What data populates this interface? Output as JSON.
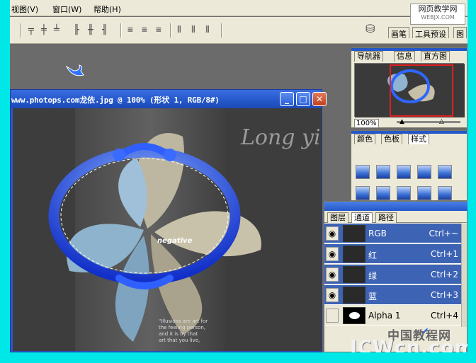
{
  "menu": {
    "items": [
      "视图(V)",
      "窗口(W)",
      "帮助(H)"
    ]
  },
  "watermark_top": {
    "line1": "网页教学网",
    "line2": "WEBJX.COM"
  },
  "palette_tabs": {
    "brushes": "画笔",
    "tool_presets": "工具预设",
    "layer_comps": "图"
  },
  "document": {
    "title": "www.photops.com龙依.jpg @ 100% (形状 1, RGB/8#)",
    "canvas_text": {
      "signature": "Long yi",
      "logo": "negative",
      "caption": [
        "\"Illusions are art for",
        "the feeling person,",
        "and it is by that",
        "art that you live,"
      ]
    }
  },
  "navigator": {
    "tabs": [
      "导航器",
      "信息",
      "直方图"
    ],
    "zoom": "100%"
  },
  "styles_palette": {
    "tabs": [
      "颜色",
      "色板",
      "样式"
    ]
  },
  "channels": {
    "tabs": [
      "图层",
      "通道",
      "路径"
    ],
    "rows": [
      {
        "name": "RGB",
        "shortcut": "Ctrl+~",
        "selected": true,
        "visible": true
      },
      {
        "name": "红",
        "shortcut": "Ctrl+1",
        "selected": true,
        "visible": true
      },
      {
        "name": "绿",
        "shortcut": "Ctrl+2",
        "selected": true,
        "visible": true
      },
      {
        "name": "蓝",
        "shortcut": "Ctrl+3",
        "selected": true,
        "visible": true
      },
      {
        "name": "Alpha 1",
        "shortcut": "Ctrl+4",
        "selected": false,
        "visible": false
      }
    ]
  },
  "watermark_bottom": {
    "cn": "中国教程网",
    "en": "JCWcn.com"
  },
  "colors": {
    "accent": "#2457c9",
    "background": "#00e7e7",
    "selected_row": "#3d63b5",
    "frame_blue": "#2a4fe0"
  }
}
